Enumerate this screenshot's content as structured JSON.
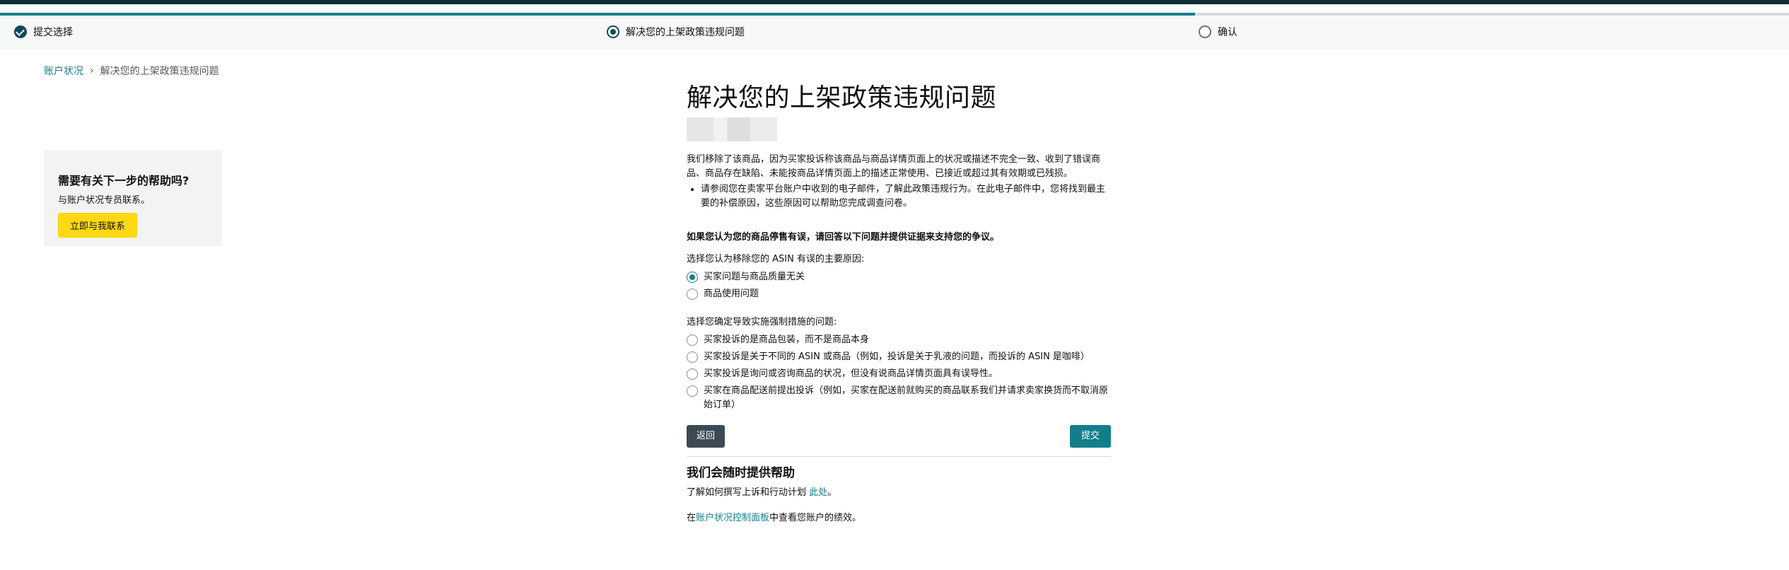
{
  "stepper": {
    "progress_percent": 66.8,
    "steps": [
      {
        "label": "提交选择",
        "state": "done"
      },
      {
        "label": "解决您的上架政策违规问题",
        "state": "current"
      },
      {
        "label": "确认",
        "state": "todo"
      }
    ]
  },
  "breadcrumb": {
    "parent": "账户状况",
    "current": "解决您的上架政策违规问题"
  },
  "help_card": {
    "title": "需要有关下一步的帮助吗?",
    "subtitle": "与账户状况专员联系。",
    "button": "立即与我联系"
  },
  "main": {
    "title": "解决您的上架政策违规问题",
    "description": "我们移除了该商品，因为买家投诉称该商品与商品详情页面上的状况或描述不完全一致、收到了错误商品、商品存在缺陷、未能按商品详情页面上的描述正常使用、已接近或超过其有效期或已残损。",
    "bullet": "请参阅您在卖家平台账户中收到的电子邮件，了解此政策违规行为。在此电子邮件中，您将找到最主要的补偿原因，这些原因可以帮助您完成调查问卷。",
    "dispute_heading": "如果您认为您的商品停售有误，请回答以下问题并提供证据来支持您的争议。",
    "q1_label": "选择您认为移除您的 ASIN 有误的主要原因:",
    "q1_options": [
      "买家问题与商品质量无关",
      "商品使用问题"
    ],
    "q2_label": "选择您确定导致实施强制措施的问题:",
    "q2_options": [
      "买家投诉的是商品包装，而不是商品本身",
      "买家投诉是关于不同的 ASIN 或商品（例如，投诉是关于乳液的问题，而投诉的 ASIN 是咖啡）",
      "买家投诉是询问或咨询商品的状况，但没有说商品详情页面具有误导性。",
      "买家在商品配送前提出投诉（例如，买家在配送前就购买的商品联系我们并请求卖家换货而不取消原始订单）"
    ],
    "back_button": "返回",
    "submit_button": "提交",
    "help_heading": "我们会随时提供帮助",
    "help_line1_prefix": "了解如何撰写上诉和行动计划 ",
    "help_line1_link": "此处",
    "help_line1_suffix": "。",
    "help_line2_prefix": "在",
    "help_line2_link": "账户状况控制面板",
    "help_line2_suffix": "中查看您账户的绩效。"
  }
}
